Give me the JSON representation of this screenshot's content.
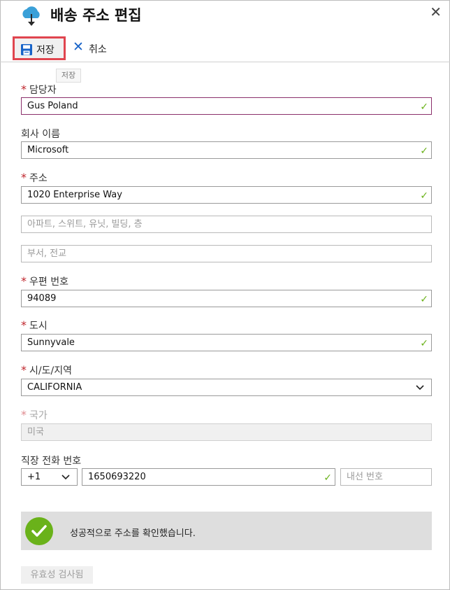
{
  "header": {
    "title": "배송 주소 편집",
    "logo_icon": "cloud-upload-icon",
    "close_icon": "close-icon"
  },
  "toolbar": {
    "save_label": "저장",
    "cancel_label": "취소",
    "tooltip": "저장"
  },
  "form": {
    "contact": {
      "label": "담당자",
      "required": true,
      "value": "Gus Poland"
    },
    "company": {
      "label": "회사 이름",
      "value": "Microsoft"
    },
    "address": {
      "label": "주소",
      "required": true,
      "value": "1020 Enterprise Way",
      "line2_placeholder": "아파트, 스위트, 유닛, 빌딩, 층",
      "line3_placeholder": "부서, 전교"
    },
    "postal": {
      "label": "우편 번호",
      "required": true,
      "value": "94089"
    },
    "city": {
      "label": "도시",
      "required": true,
      "value": "Sunnyvale"
    },
    "state": {
      "label": "시/도/지역",
      "required": true,
      "value": "CALIFORNIA"
    },
    "country": {
      "label": "국가",
      "required": true,
      "value": "미국"
    },
    "phone": {
      "label": "직장 전화 번호",
      "country_code": "+1",
      "number": "1650693220",
      "extension_placeholder": "내선 번호"
    }
  },
  "status": {
    "message": "성공적으로 주소를 확인했습니다."
  },
  "validated_button": "유효성 검사됨",
  "colors": {
    "accent": "#1763c8",
    "valid": "#6ab21a",
    "required": "#c0262d",
    "highlight": "#e0454f"
  }
}
